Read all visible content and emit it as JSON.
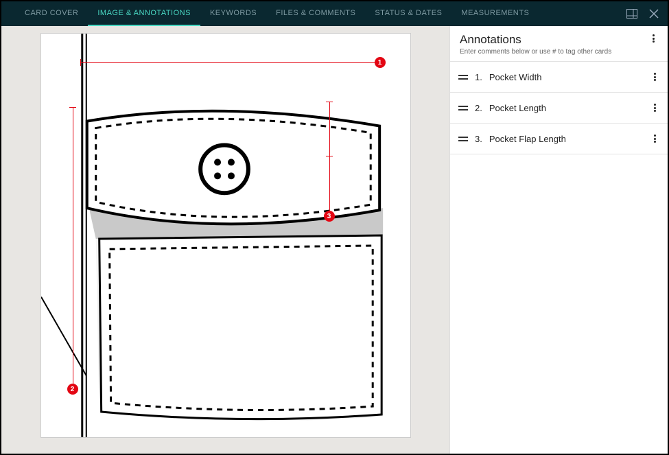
{
  "tabs": {
    "card_cover": "CARD COVER",
    "image_annotations": "IMAGE & ANNOTATIONS",
    "keywords": "KEYWORDS",
    "files_comments": "FILES & COMMENTS",
    "status_dates": "STATUS & DATES",
    "measurements": "MEASUREMENTS"
  },
  "sidebar": {
    "title": "Annotations",
    "subtitle": "Enter comments below or use # to tag other cards",
    "items": [
      {
        "num": "1.",
        "label": "Pocket Width"
      },
      {
        "num": "2.",
        "label": "Pocket Length"
      },
      {
        "num": "3.",
        "label": "Pocket Flap Length"
      }
    ]
  },
  "markers": {
    "m1": "1",
    "m2": "2",
    "m3": "3"
  }
}
